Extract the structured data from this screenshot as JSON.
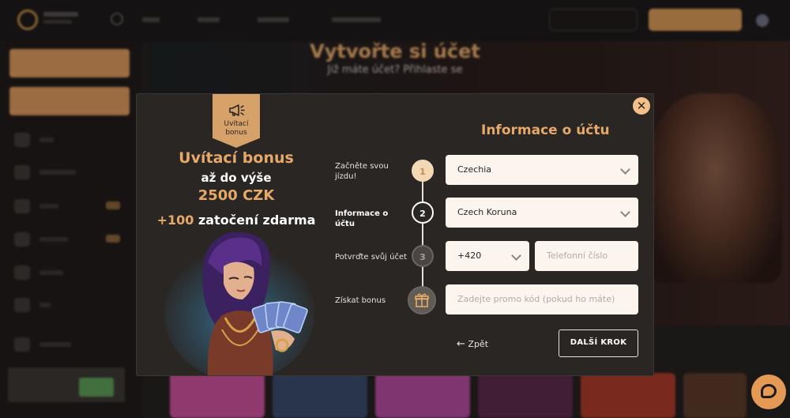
{
  "background": {
    "hero_title": "Vytvořte si účet",
    "hero_subtitle": "Již máte účet? Přihlaste se"
  },
  "modal": {
    "ribbon_label": "Uvítací bonus",
    "bonus": {
      "title": "Uvítací bonus",
      "line2": "až do výše",
      "amount": "2500 CZK",
      "spins_count": "+100",
      "spins_text": "zatočení zdarma"
    },
    "form_title": "Informace o účtu",
    "steps": [
      {
        "label": "Začněte svou jízdu!",
        "number": "1",
        "state": "done"
      },
      {
        "label": "Informace o účtu",
        "number": "2",
        "state": "active"
      },
      {
        "label": "Potvrďte svůj účet",
        "number": "3",
        "state": "pending"
      },
      {
        "label": "Získat bonus",
        "icon": "gift-icon",
        "state": "pending"
      }
    ],
    "fields": {
      "country": "Czechia",
      "currency": "Czech Koruna",
      "phone_prefix": "+420",
      "phone_placeholder": "Telefonní číslo",
      "promo_placeholder": "Zadejte promo kód (pokud ho máte)"
    },
    "back_label": "Zpět",
    "next_label": "DALŠÍ KROK",
    "close_symbol": "✕"
  },
  "colors": {
    "accent": "#e6a969",
    "modal_bg": "#2a2624",
    "field_bg": "#fbf5ee"
  }
}
